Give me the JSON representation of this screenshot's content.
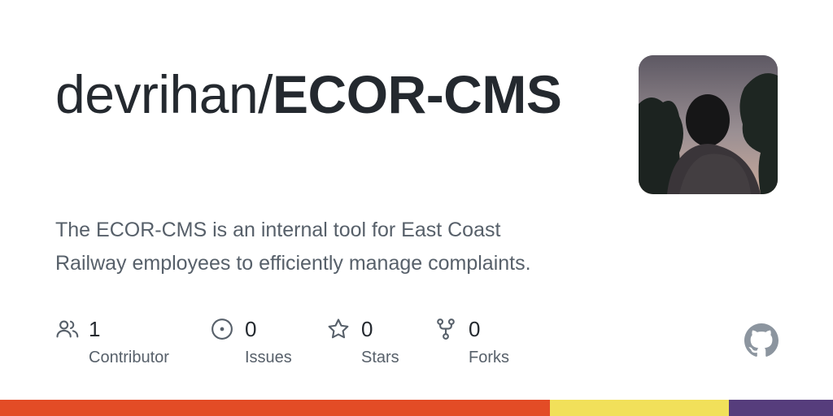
{
  "repo": {
    "owner": "devrihan/",
    "name": "ECOR-CMS",
    "description": "The ECOR-CMS is an internal tool for East Coast Railway employees to efficiently manage complaints."
  },
  "stats": [
    {
      "icon": "people-icon",
      "count": "1",
      "label": "Contributor"
    },
    {
      "icon": "issue-icon",
      "count": "0",
      "label": "Issues"
    },
    {
      "icon": "star-icon",
      "count": "0",
      "label": "Stars"
    },
    {
      "icon": "fork-icon",
      "count": "0",
      "label": "Forks"
    }
  ],
  "colors": {
    "text_primary": "#24292f",
    "text_secondary": "#57606a",
    "language_bar": [
      "#e34c26",
      "#f1e05a",
      "#563d7c"
    ]
  },
  "language_bar_fractions": [
    0.66,
    0.215,
    0.125
  ]
}
